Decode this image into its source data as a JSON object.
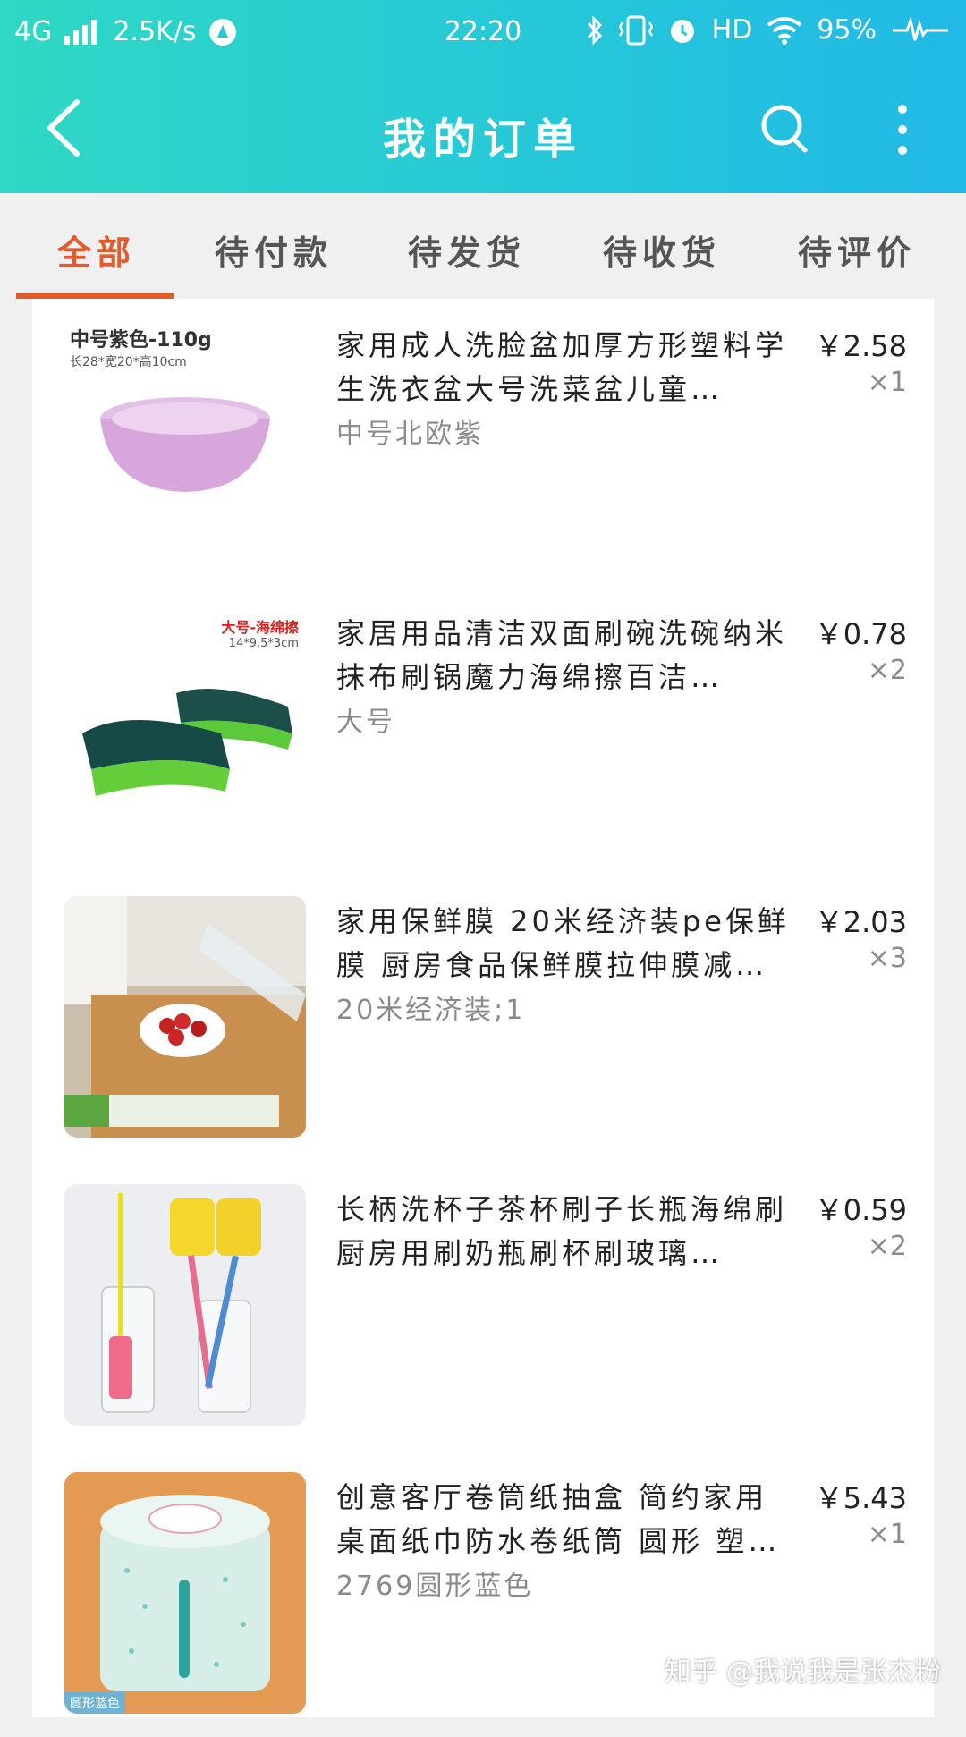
{
  "status_bar": {
    "network": "4G",
    "speed": "2.5K/s",
    "time": "22:20",
    "hd": "HD",
    "battery": "95%"
  },
  "header": {
    "title": "我的订单",
    "back_icon": "chevron-left-icon",
    "search_icon": "search-icon",
    "more_icon": "more-vertical-icon"
  },
  "tabs": [
    {
      "label": "全部",
      "active": true
    },
    {
      "label": "待付款",
      "active": false
    },
    {
      "label": "待发货",
      "active": false
    },
    {
      "label": "待收货",
      "active": false
    },
    {
      "label": "待评价",
      "active": false
    }
  ],
  "orders": [
    {
      "title": "家用成人洗脸盆加厚方形塑料学生洗衣盆大号洗菜盆儿童…",
      "spec": "中号北欧紫",
      "price": "￥2.58",
      "qty": "×1",
      "thumb_text_1": "中号紫色-110g",
      "thumb_text_2": "长28*宽20*高10cm"
    },
    {
      "title": "家居用品清洁双面刷碗洗碗纳米抹布刷锅魔力海绵擦百洁…",
      "spec": "大号",
      "price": "￥0.78",
      "qty": "×2",
      "thumb_text_1": "大号-海绵擦",
      "thumb_text_2": "14*9.5*3cm"
    },
    {
      "title": "家用保鲜膜 20米经济装pe保鲜膜 厨房食品保鲜膜拉伸膜减…",
      "spec": "20米经济装;1",
      "price": "￥2.03",
      "qty": "×3"
    },
    {
      "title": "长柄洗杯子茶杯刷子长瓶海绵刷厨房用刷奶瓶刷杯刷玻璃…",
      "spec": "",
      "price": "￥0.59",
      "qty": "×2"
    },
    {
      "title": "创意客厅卷筒纸抽盒 简约家用桌面纸巾防水卷纸筒 圆形 塑…",
      "spec": "2769圆形蓝色",
      "price": "￥5.43",
      "qty": "×1",
      "thumb_text_1": "圆形蓝色"
    }
  ],
  "watermark": "知乎 @我说我是张杰粉",
  "colors": {
    "header_start": "#2fd8c4",
    "header_end": "#21b9e6",
    "accent": "#e35a2b",
    "muted": "#8a8a8a"
  }
}
